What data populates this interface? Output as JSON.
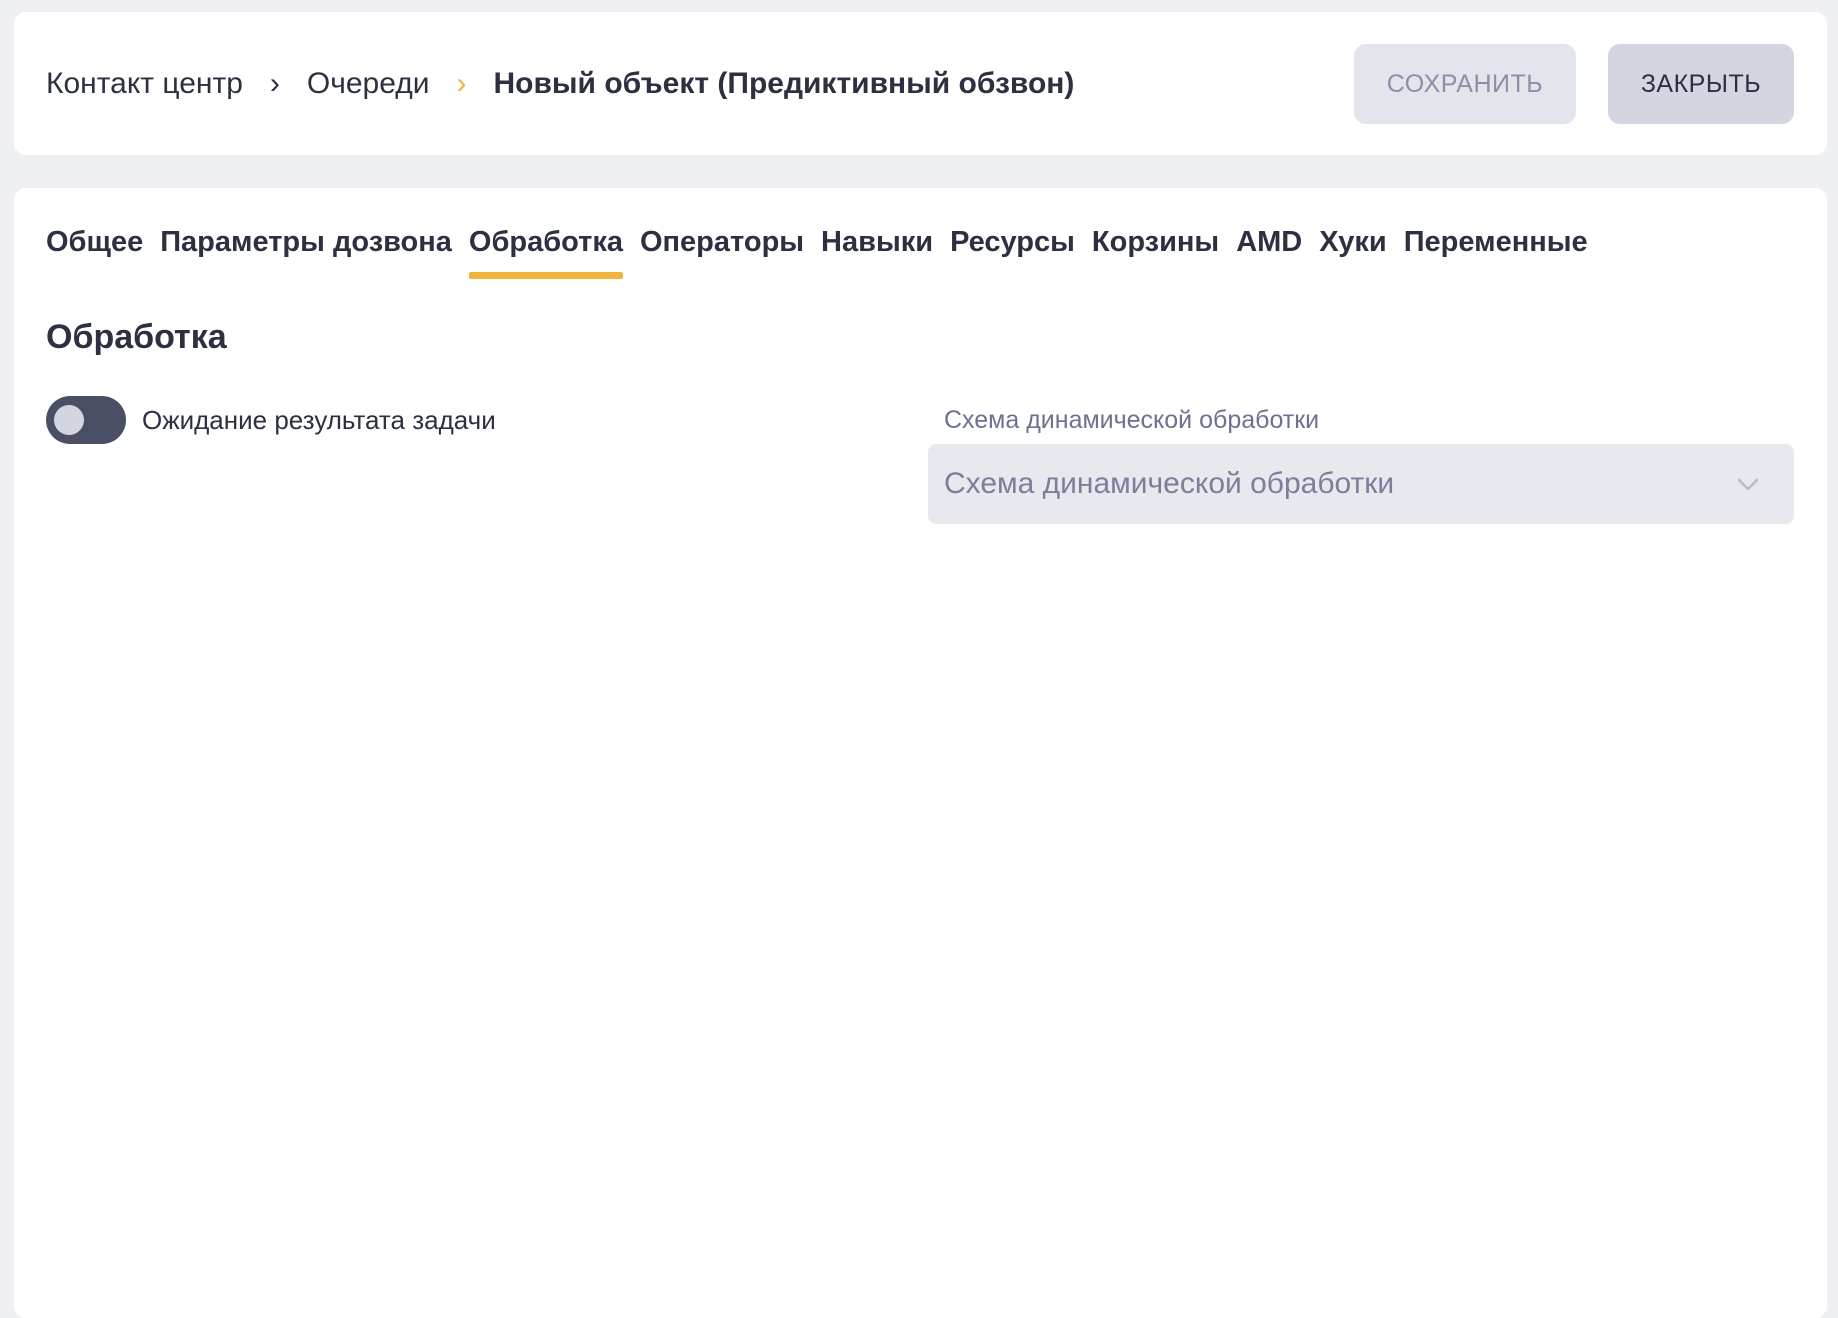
{
  "breadcrumb": {
    "items": [
      "Контакт центр",
      "Очереди"
    ],
    "current": "Новый объект (Предиктивный обзвон)",
    "separator": "›"
  },
  "actions": {
    "save_label": "СОХРАНИТЬ",
    "close_label": "ЗАКРЫТЬ"
  },
  "tabs": [
    {
      "label": "Общее",
      "active": false
    },
    {
      "label": "Параметры дозвона",
      "active": false
    },
    {
      "label": "Обработка",
      "active": true
    },
    {
      "label": "Операторы",
      "active": false
    },
    {
      "label": "Навыки",
      "active": false
    },
    {
      "label": "Ресурсы",
      "active": false
    },
    {
      "label": "Корзины",
      "active": false
    },
    {
      "label": "AMD",
      "active": false
    },
    {
      "label": "Хуки",
      "active": false
    },
    {
      "label": "Переменные",
      "active": false
    }
  ],
  "section": {
    "title": "Обработка",
    "toggle": {
      "label": "Ожидание результата задачи",
      "on": false
    },
    "dynamic_scheme": {
      "label": "Схема динамической обработки",
      "placeholder": "Схема динамической обработки",
      "value": ""
    }
  },
  "colors": {
    "accent": "#f0b53a",
    "text": "#2c3040",
    "background": "#eff0f4",
    "toggle_track": "#4a4f66"
  }
}
